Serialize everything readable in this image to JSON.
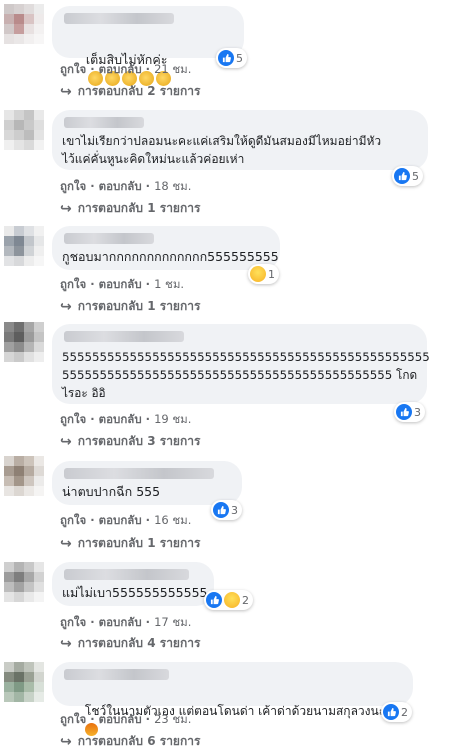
{
  "comments": [
    {
      "text": "เต็มสิบไม่หักค่ะ",
      "like_label": "ถูกใจ",
      "reply_label": "ตอบกลับ",
      "time": "21 ชม.",
      "reaction_count": "5",
      "replies": "การตอบกลับ 2 รายการ",
      "emoji": "clapping-hands"
    },
    {
      "text": "เขาไม่เรียกว่าปลอมนะคะแค่เสริมให้ดูดีมันสมองมีไหมอย่ามีหัว\nไว้แค่คั่นหูนะคิดใหม่นะแล้วค่อยเห่า",
      "like_label": "ถูกใจ",
      "reply_label": "ตอบกลับ",
      "time": "18 ชม.",
      "reaction_count": "5",
      "replies": "การตอบกลับ 1 รายการ"
    },
    {
      "text": "กูชอบมากกกกกกกกกกกกก555555555",
      "like_label": "ถูกใจ",
      "reply_label": "ตอบกลับ",
      "time": "1 ชม.",
      "reaction_count": "1",
      "replies": "การตอบกลับ 1 รายการ"
    },
    {
      "text": "5555555555555555555555555555555555555555555555555\n55555555555555555555555555555555555555555555 โกด\nไรอะ อิอิ",
      "like_label": "ถูกใจ",
      "reply_label": "ตอบกลับ",
      "time": "19 ชม.",
      "reaction_count": "3",
      "replies": "การตอบกลับ 3 รายการ"
    },
    {
      "text": "น่าตบปากฉีก 555",
      "like_label": "ถูกใจ",
      "reply_label": "ตอบกลับ",
      "time": "16 ชม.",
      "reaction_count": "3",
      "replies": "การตอบกลับ 1 รายการ"
    },
    {
      "text": "แม่ไม่เบา555555555555",
      "like_label": "ถูกใจ",
      "reply_label": "ตอบกลับ",
      "time": "17 ชม.",
      "reaction_count": "2",
      "replies": "การตอบกลับ 4 รายการ"
    },
    {
      "text": "โชว์ในนามตัวเอง แต่ตอนโดนด่า เค้าด่าด้วยนามสกุลวงนะ",
      "like_label": "ถูกใจ",
      "reply_label": "ตอบกลับ",
      "time": "23 ชม.",
      "reaction_count": "2",
      "replies": "การตอบกลับ 6 รายการ",
      "emoji": "angry-face"
    }
  ],
  "colors": {
    "bubble": "#f0f2f5",
    "meta_text": "#65676b",
    "like_blue": "#1877f2"
  }
}
